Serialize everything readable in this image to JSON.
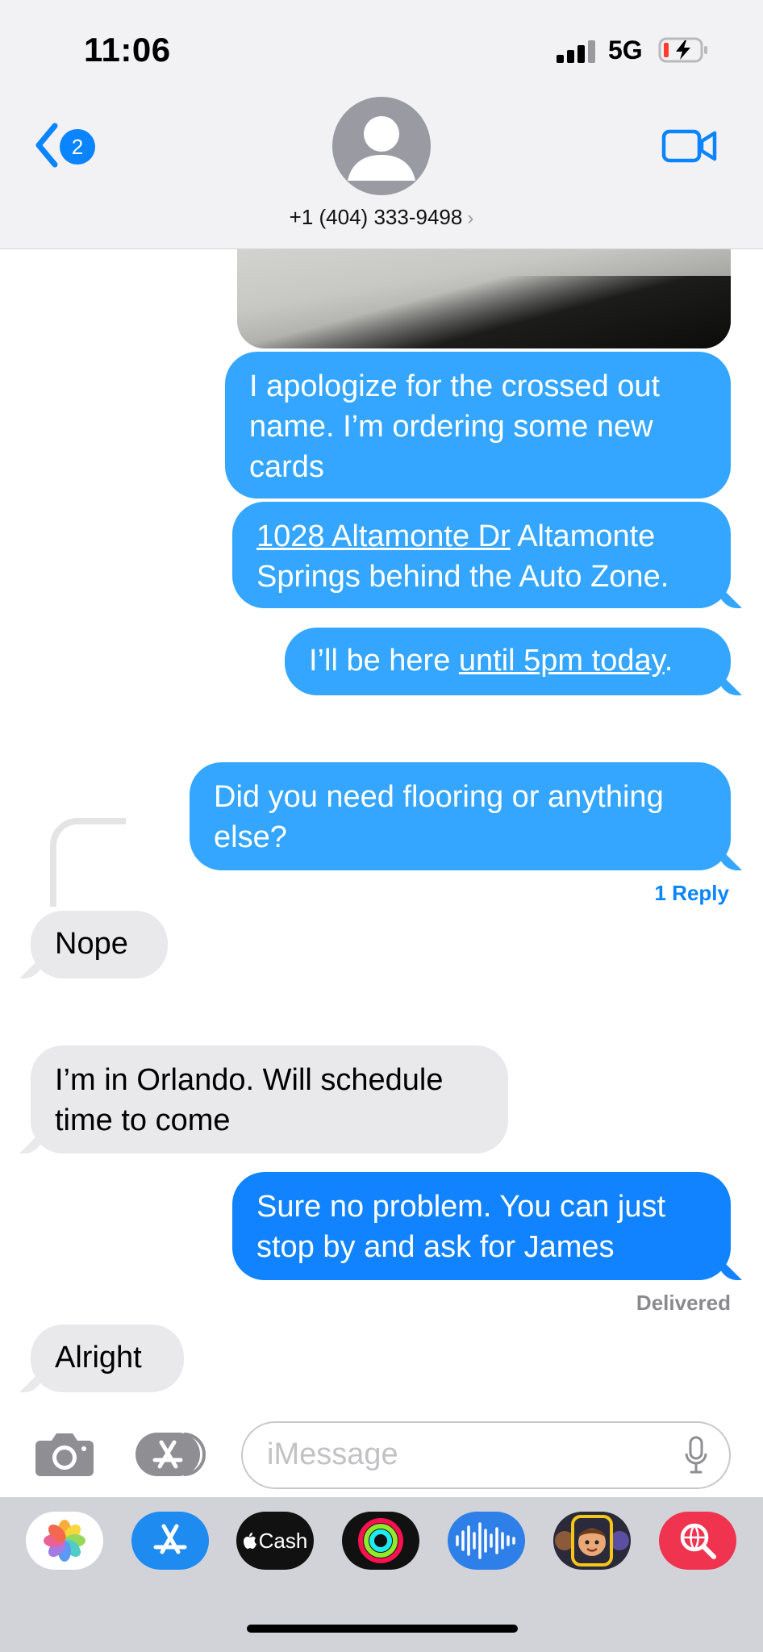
{
  "status_bar": {
    "time": "11:06",
    "network": "5G"
  },
  "header": {
    "back_badge": "2",
    "contact": "+1 (404) 333-9498",
    "chevron": "›"
  },
  "messages": [
    {
      "dir": "out",
      "parts": [
        {
          "text": "I apologize for the crossed out name. I’m ordering some new cards",
          "link": false
        }
      ]
    },
    {
      "dir": "out",
      "parts": [
        {
          "text": "1028 Altamonte Dr",
          "link": true
        },
        {
          "text": " Altamonte Springs behind the Auto Zone.",
          "link": false
        }
      ]
    },
    {
      "dir": "out",
      "parts": [
        {
          "text": "I’ll be here ",
          "link": false
        },
        {
          "text": "until 5pm today",
          "link": true
        },
        {
          "text": ".",
          "link": false
        }
      ]
    },
    {
      "dir": "out",
      "parts": [
        {
          "text": "Did you need flooring or anything else?",
          "link": false
        }
      ]
    },
    {
      "dir": "in",
      "parts": [
        {
          "text": "Nope",
          "link": false
        }
      ]
    },
    {
      "dir": "in",
      "parts": [
        {
          "text": "I’m in Orlando. Will schedule time to come",
          "link": false
        }
      ]
    },
    {
      "dir": "out",
      "parts": [
        {
          "text": "Sure no problem. You can just stop by and ask for James",
          "link": false
        }
      ]
    },
    {
      "dir": "in",
      "parts": [
        {
          "text": "Alright",
          "link": false
        }
      ]
    }
  ],
  "reply_count": "1 Reply",
  "delivered": "Delivered",
  "input": {
    "placeholder": "iMessage"
  },
  "drawer": {
    "apps": [
      {
        "name": "Photos",
        "icon": "photos-icon"
      },
      {
        "name": "App Store",
        "icon": "app-store-icon"
      },
      {
        "name": "Cash",
        "label": "Cash",
        "icon": "apple-cash-icon"
      },
      {
        "name": "Fitness",
        "icon": "activity-rings-icon"
      },
      {
        "name": "Audio",
        "icon": "audio-waveform-icon"
      },
      {
        "name": "Memoji",
        "icon": "memoji-icon"
      },
      {
        "name": "Images",
        "icon": "image-search-icon"
      }
    ]
  },
  "colors": {
    "outgoing": "#34a6ff",
    "outgoing_latest": "#1183ff",
    "incoming": "#e9e9eb",
    "accent": "#0a84ff"
  }
}
